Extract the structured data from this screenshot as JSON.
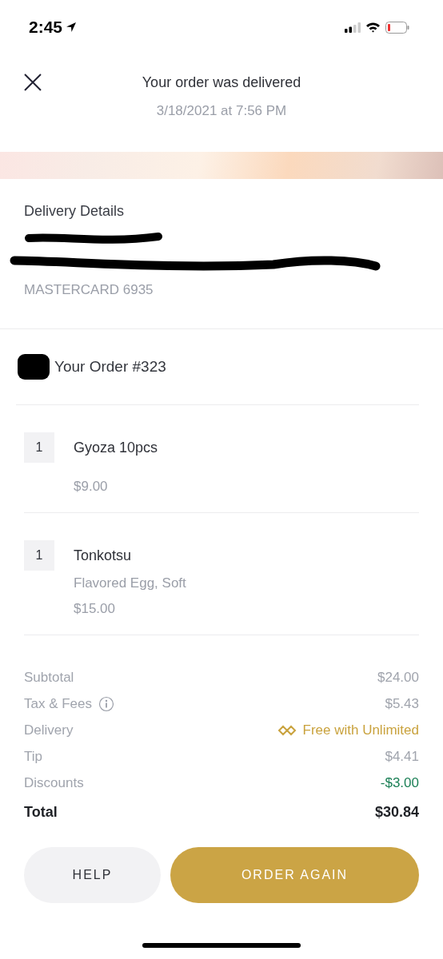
{
  "status_bar": {
    "time": "2:45"
  },
  "header": {
    "title": "Your order was delivered",
    "subtitle": "3/18/2021 at 7:56 PM"
  },
  "delivery_details": {
    "heading": "Delivery Details",
    "payment": "MASTERCARD 6935"
  },
  "order": {
    "title": "Your Order #323",
    "items": [
      {
        "quantity": "1",
        "name": "Gyoza 10pcs",
        "price": "$9.00"
      },
      {
        "quantity": "1",
        "name": "Tonkotsu",
        "options": [
          "Flavored Egg, Soft"
        ],
        "price": "$15.00"
      }
    ]
  },
  "totals": [
    {
      "kind": "plain",
      "label": "Subtotal",
      "value": "$24.00"
    },
    {
      "kind": "info",
      "label": "Tax & Fees",
      "value": "$5.43"
    },
    {
      "kind": "unlimited",
      "label": "Delivery",
      "value": "Free with Unlimited"
    },
    {
      "kind": "plain",
      "label": "Tip",
      "value": "$4.41"
    },
    {
      "kind": "discount",
      "label": "Discounts",
      "value": "-$3.00"
    },
    {
      "kind": "total",
      "label": "Total",
      "value": "$30.84"
    }
  ],
  "buttons": [
    {
      "kind": "secondary",
      "label": "HELP"
    },
    {
      "kind": "primary",
      "label": "ORDER AGAIN"
    }
  ]
}
